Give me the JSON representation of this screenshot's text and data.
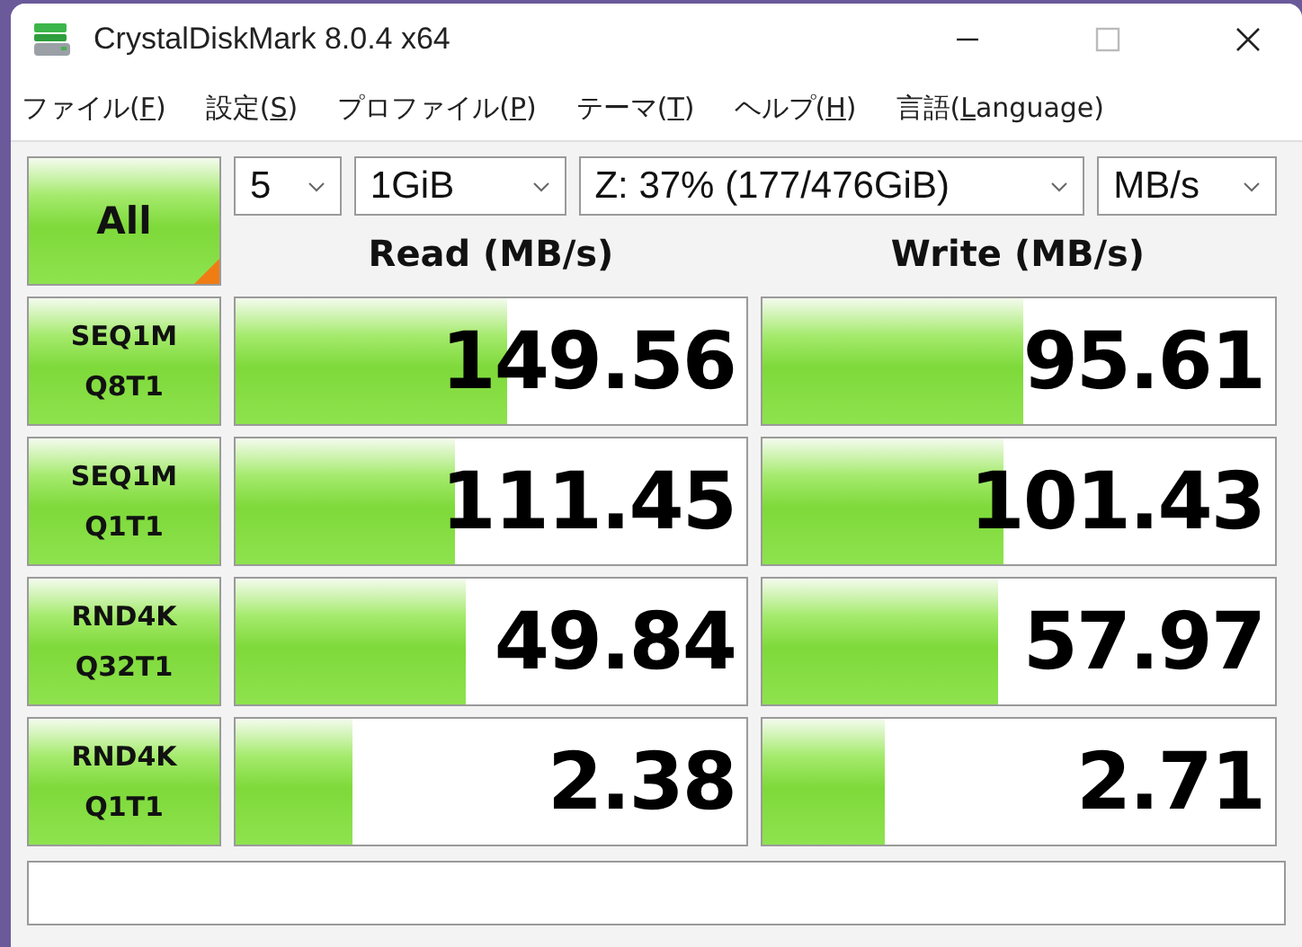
{
  "window": {
    "title": "CrystalDiskMark 8.0.4 x64"
  },
  "menu": [
    {
      "before": "ファイル(",
      "key": "F",
      "after": ")"
    },
    {
      "before": "設定(",
      "key": "S",
      "after": ")"
    },
    {
      "before": "プロファイル(",
      "key": "P",
      "after": ")"
    },
    {
      "before": "テーマ(",
      "key": "T",
      "after": ")"
    },
    {
      "before": "ヘルプ(",
      "key": "H",
      "after": ")"
    },
    {
      "before": "言語(",
      "key": "L",
      "after": "anguage)"
    }
  ],
  "all_button": "All",
  "selectors": [
    {
      "kind": "count",
      "value": "5"
    },
    {
      "kind": "size",
      "value": "1GiB"
    },
    {
      "kind": "drive",
      "value": "Z: 37% (177/476GiB)"
    },
    {
      "kind": "unit",
      "value": "MB/s"
    }
  ],
  "columns": [
    "Read (MB/s)",
    "Write (MB/s)"
  ],
  "rows": [
    {
      "test": [
        "SEQ1M",
        "Q8T1"
      ],
      "read": {
        "value": "149.56",
        "level": 0.53
      },
      "write": {
        "value": "95.61",
        "level": 0.51
      }
    },
    {
      "test": [
        "SEQ1M",
        "Q1T1"
      ],
      "read": {
        "value": "111.45",
        "level": 0.43
      },
      "write": {
        "value": "101.43",
        "level": 0.47
      }
    },
    {
      "test": [
        "RND4K",
        "Q32T1"
      ],
      "read": {
        "value": "49.84",
        "level": 0.45
      },
      "write": {
        "value": "57.97",
        "level": 0.46
      }
    },
    {
      "test": [
        "RND4K",
        "Q1T1"
      ],
      "read": {
        "value": "2.38",
        "level": 0.23
      },
      "write": {
        "value": "2.71",
        "level": 0.24
      }
    }
  ]
}
